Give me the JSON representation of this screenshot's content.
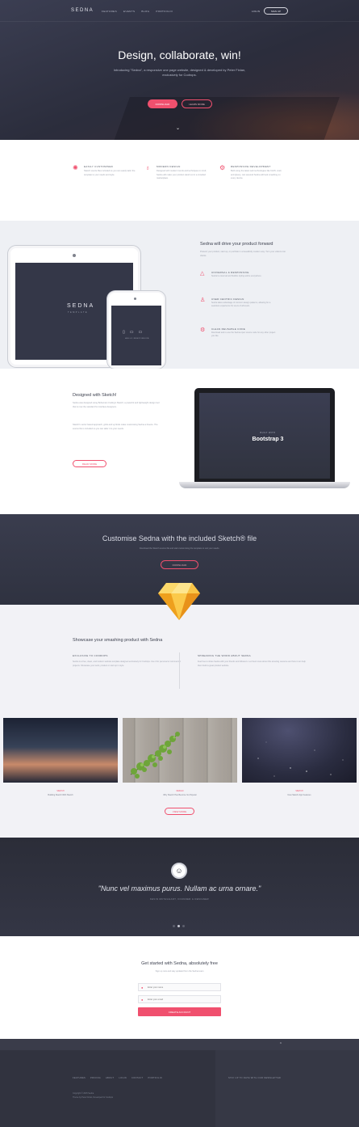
{
  "nav": {
    "logo": "SEDNA",
    "links": [
      "FEATURES",
      "EVENTS",
      "BLOG",
      "PORTFOLIO"
    ],
    "login": "LOG IN",
    "signup": "SIGN UP"
  },
  "hero": {
    "title": "Design, collaborate, win!",
    "subtitle": "Introducing \"Sedna\", a responsive one page website, designed & developed by Peter Finlan, exclusively for Codrops.",
    "btn_primary": "DOWNLOAD",
    "btn_secondary": "LEARN MORE",
    "down_icon": "chevron-down-icon"
  },
  "features": [
    {
      "icon": "bolt-icon",
      "title": "EASILY CUSTOMISED",
      "text": "Sketch source files included so you can easily tailor the template to your needs and style."
    },
    {
      "icon": "lightbulb-icon",
      "title": "MODERN DESIGN",
      "text": "Designed with modern trends and techniques in mind; Sedna will make your product stand out in a crowded marketplace."
    },
    {
      "icon": "gear-icon",
      "title": "RESPONSIVE DEVELOPMENT",
      "text": "Built using the latest web technologies like html5, css3, and jQuery, rest assured Sedna will look smashing on every device."
    }
  ],
  "tablet_section": {
    "device_logo": "SEDNA",
    "device_logo_sub": "TEMPLATE",
    "phone_caption": "HELLO RESPONSIVE",
    "title": "Sedna will drive your product forward",
    "intro": "Present your product, start up, or portfolio in a beautifully modern way. Turn your visitors into clients.",
    "items": [
      {
        "icon": "warning-icon",
        "title": "UNIVERSAL & RESPONSIVE",
        "text": "Sedna's universal and flexible styling works everywhere."
      },
      {
        "icon": "user-icon",
        "title": "USER CENTRIC DESIGN",
        "text": "Sedna takes advantage of common design patterns, allowing for a seamless experience for users of all levels."
      },
      {
        "icon": "gear-icon",
        "title": "CLEAN REUSABLE CODE",
        "text": "Download and re-use the Sedna open source code for any other project you like."
      }
    ]
  },
  "sketch_section": {
    "title": "Designed with Sketch!",
    "text1": "Sedna was designed using Bohemian Coding's Sketch; a powerful and lightweight design tool that is now the standard for interface designers.",
    "text2": "Sketch's vector based approach, grids and symbols make customising Sedna a breeze. The source file is included so you can tailor it to your needs.",
    "button": "READ MORE",
    "laptop_sub": "BUILT WITH",
    "laptop_big": "Bootstrap 3"
  },
  "customise": {
    "title": "Customise Sedna with the included Sketch® file",
    "subtitle": "Download the Sketch source file and start customising the template to suit your needs.",
    "button": "DOWNLOAD"
  },
  "showcase": {
    "title": "Showcase your smashing product with Sedna",
    "col1_title": "EXCLUSIVE TO CODROPS",
    "col1_text": "Sedna is a free, clean, and modern website template designed exclusively for Codrops. Use it for personal or commercial projects. Showcase your work, product or start up in style.",
    "col2_title": "SPREADING THE WORD ABOUT SEDNA",
    "col2_text": "Feel free to share Sedna with your friends and followers. Let them know about this amazing resource and how it can help them build a great product website.",
    "cards": [
      {
        "kicker": "SKETCH",
        "title": "Building Sketch With Sketch"
      },
      {
        "kicker": "DESIGN",
        "title": "Why Sketch Has Become So Popular"
      },
      {
        "kicker": "SKETCH",
        "title": "New Sketch App Features"
      }
    ],
    "view_more": "VIEW MORE"
  },
  "testimonial": {
    "avatar_icon": "avatar-icon",
    "quote": "\"Nunc vel maximus purus. Nullam ac urna ornare.\"",
    "author": "KEVIN MCTAGGART, FOUNDER & DESIGNER"
  },
  "signup": {
    "title": "Get started with Sedna, absolutely free",
    "subtitle": "Sign up now and stay updated from the Sedna team",
    "name_placeholder": "Enter your name",
    "email_placeholder": "Enter your email",
    "button": "CREATE ACCOUNT"
  },
  "footer": {
    "links": [
      "FEATURES",
      "PRICING",
      "ABOUT",
      "LOGIN",
      "CONTACT",
      "PORTFOLIO"
    ],
    "copyright": "Copyright © 2015 Sedna",
    "credits": "Theme by Peter Finlan, Developed for Codrops",
    "newsletter": "STAY UP TO DATE WITH OUR NEWSLETTER"
  },
  "colors": {
    "accent": "#f0506e",
    "dark": "#343748",
    "light_bg": "#f2f2f6"
  }
}
